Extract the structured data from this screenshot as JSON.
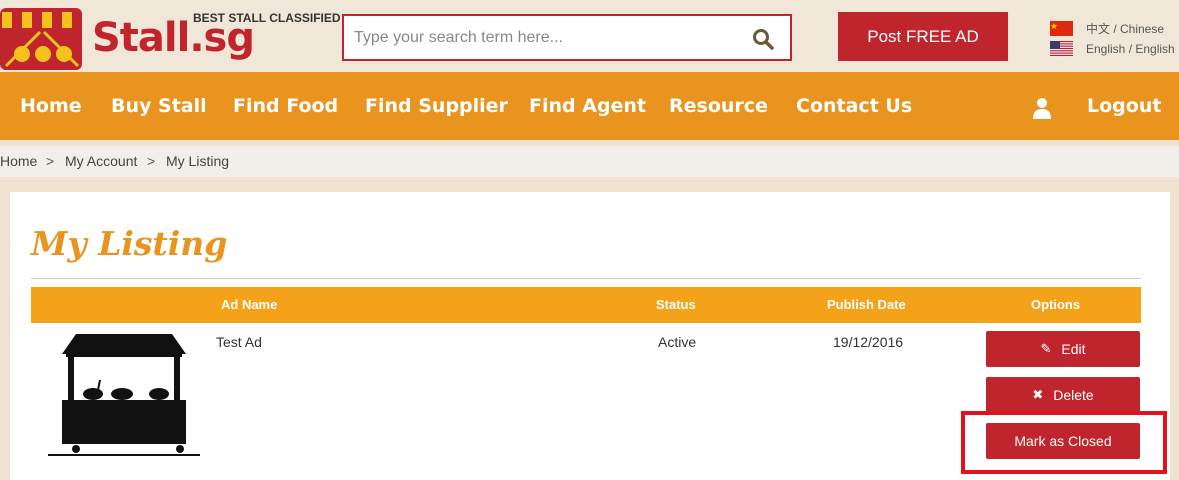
{
  "header": {
    "logo_text": "Stall.sg",
    "tagline": "BEST STALL CLASSIFIED",
    "search_placeholder": "Type your search term here...",
    "post_ad_label": "Post FREE AD",
    "languages": [
      {
        "label": "中文 / Chinese",
        "flag": "china-flag-icon"
      },
      {
        "label": "English / English",
        "flag": "usa-flag-icon"
      }
    ]
  },
  "nav": {
    "items": [
      "Home",
      "Buy Stall",
      "Find Food",
      "Find Supplier",
      "Find Agent",
      "Resource",
      "Contact Us"
    ],
    "user_icon": "user-icon",
    "logout_label": "Logout"
  },
  "breadcrumb": {
    "items": [
      "Home",
      "My Account",
      "My Listing"
    ],
    "separator": ">"
  },
  "page": {
    "title": "My Listing"
  },
  "table": {
    "headers": [
      "Ad Name",
      "Status",
      "Publish Date",
      "Options"
    ],
    "rows": [
      {
        "ad_name": "Test Ad",
        "status": "Active",
        "publish_date": "19/12/2016",
        "image": "stall-image"
      }
    ]
  },
  "options": {
    "edit_label": "Edit",
    "delete_label": "Delete",
    "mark_closed_label": "Mark as Closed"
  },
  "colors": {
    "brand_red": "#c0252e",
    "nav_orange": "#e8941e",
    "table_header": "#f5a21b",
    "highlight_red": "#e0121b"
  }
}
